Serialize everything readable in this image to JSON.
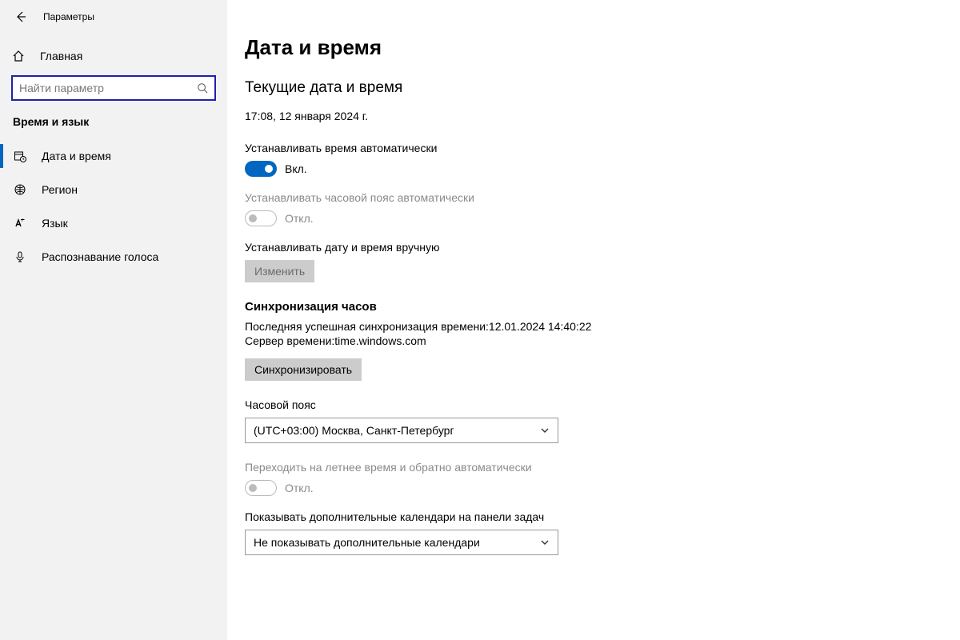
{
  "header": {
    "title": "Параметры"
  },
  "sidebar": {
    "home": "Главная",
    "search_placeholder": "Найти параметр",
    "category": "Время и язык",
    "items": [
      {
        "label": "Дата и время"
      },
      {
        "label": "Регион"
      },
      {
        "label": "Язык"
      },
      {
        "label": "Распознавание голоса"
      }
    ]
  },
  "main": {
    "title": "Дата и время",
    "current_heading": "Текущие дата и время",
    "current_value": "17:08, 12 января 2024 г.",
    "auto_time": {
      "label": "Устанавливать время автоматически",
      "state": "Вкл."
    },
    "auto_tz": {
      "label": "Устанавливать часовой пояс автоматически",
      "state": "Откл."
    },
    "manual": {
      "label": "Устанавливать дату и время вручную",
      "button": "Изменить"
    },
    "sync": {
      "heading": "Синхронизация часов",
      "last": "Последняя успешная синхронизация времени:12.01.2024 14:40:22",
      "server": "Сервер времени:time.windows.com",
      "button": "Синхронизировать"
    },
    "timezone": {
      "label": "Часовой пояс",
      "value": "(UTC+03:00) Москва, Санкт-Петербург"
    },
    "dst": {
      "label": "Переходить на летнее время и обратно автоматически",
      "state": "Откл."
    },
    "extra_cal": {
      "label": "Показывать дополнительные календари на панели задач",
      "value": "Не показывать дополнительные календари"
    }
  }
}
